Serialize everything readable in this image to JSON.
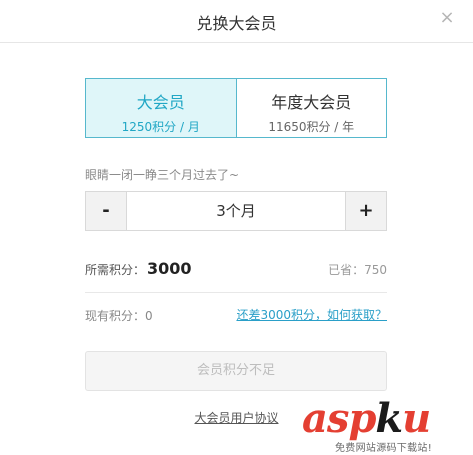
{
  "dialog": {
    "title": "兑换大会员",
    "close_icon": "×"
  },
  "plans": [
    {
      "name": "大会员",
      "price": "1250积分 / 月",
      "selected": true
    },
    {
      "name": "年度大会员",
      "price": "11650积分 / 年",
      "selected": false
    }
  ],
  "duration": {
    "hint": "眼睛一闭一睁三个月过去了~",
    "minus": "-",
    "value": "3个月",
    "plus": "+"
  },
  "summary": {
    "required_label": "所需积分：",
    "required_value": "3000",
    "saved_text": "已省：750",
    "current_text": "现有积分：0",
    "earn_link": "还差3000积分，如何获取？"
  },
  "actions": {
    "submit_label": "会员积分不足",
    "agreement_link": "大会员用户协议"
  },
  "watermark": {
    "logo_part1": "asp",
    "logo_part2": "k",
    "logo_part3": "u",
    "logo_suffix": ".com",
    "tagline": "免费网站源码下载站!"
  },
  "colors": {
    "accent": "#21a7c5",
    "selected_bg": "#dff6f9",
    "link": "#2a9fc8",
    "logo_red": "#e43f32"
  }
}
